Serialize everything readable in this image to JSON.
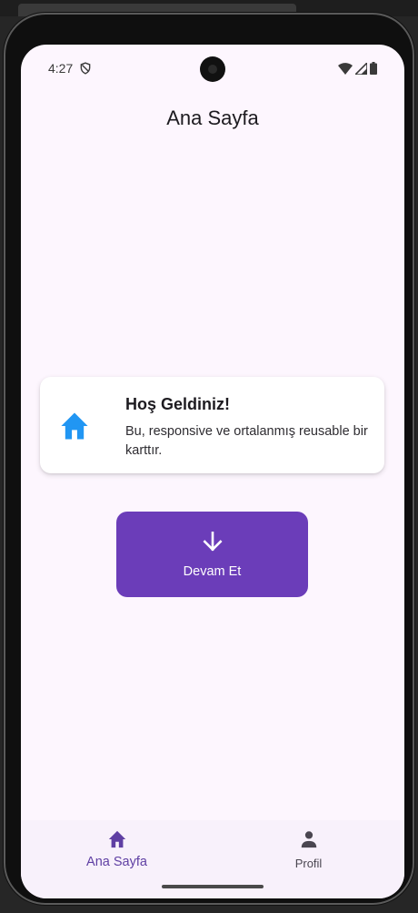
{
  "status_bar": {
    "time": "4:27"
  },
  "app_bar": {
    "title": "Ana Sayfa"
  },
  "welcome_card": {
    "icon": "home-icon",
    "title": "Hoş Geldiniz!",
    "body": "Bu, responsive ve ortalanmış reusable bir karttır."
  },
  "continue_button": {
    "icon": "arrow-down-icon",
    "label": "Devam Et"
  },
  "bottom_nav": {
    "items": [
      {
        "label": "Ana Sayfa",
        "icon": "home-icon",
        "selected": true
      },
      {
        "label": "Profil",
        "icon": "person-icon",
        "selected": false
      }
    ]
  },
  "colors": {
    "background": "#fdf6fe",
    "accent": "#6b3db9",
    "card_icon": "#2196f3",
    "nav_selected": "#5f3fa3"
  }
}
